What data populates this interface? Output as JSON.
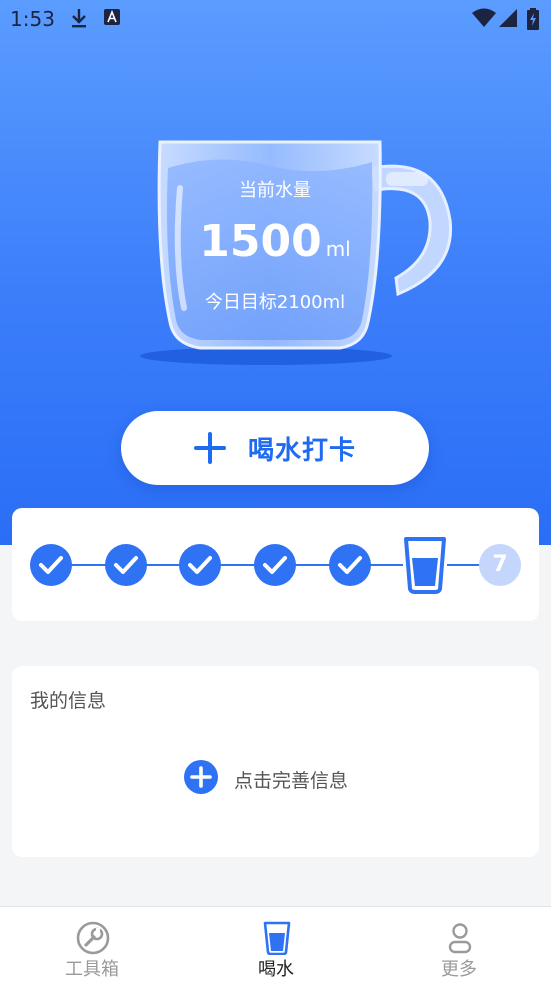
{
  "status_bar": {
    "time": "1:53",
    "icons": [
      "download-icon",
      "font-app-icon",
      "wifi-icon",
      "signal-icon",
      "battery-charging-icon"
    ]
  },
  "water": {
    "current_label": "当前水量",
    "current_amount": "1500",
    "unit": "ml",
    "target_text": "今日目标2100ml"
  },
  "checkin_button": {
    "icon": "plus-icon",
    "label": "喝水打卡"
  },
  "progress": {
    "completed_steps": 5,
    "current_step": 6,
    "next_step_label": "7"
  },
  "info_card": {
    "title": "我的信息",
    "action_icon": "plus-circle-icon",
    "action_label": "点击完善信息"
  },
  "tab_bar": {
    "tabs": [
      {
        "label": "工具箱",
        "icon": "wrench-icon",
        "active": false
      },
      {
        "label": "喝水",
        "icon": "water-cup-icon",
        "active": true
      },
      {
        "label": "更多",
        "icon": "person-icon",
        "active": false
      }
    ]
  },
  "colors": {
    "primary": "#2f72f4",
    "hero_top": "#5b9cff",
    "hero_bottom": "#2a6ef6",
    "inactive_tab": "#9a9a9a",
    "active_tab": "#222222"
  }
}
